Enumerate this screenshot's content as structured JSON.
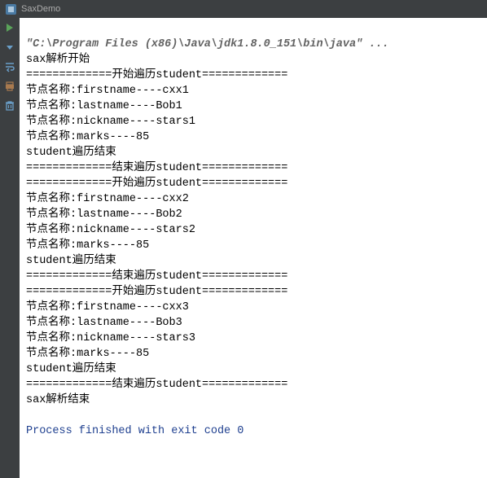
{
  "title": "SaxDemo",
  "console": {
    "command": "\"C:\\Program Files (x86)\\Java\\jdk1.8.0_151\\bin\\java\" ...",
    "lines": [
      "sax解析开始",
      "=============开始遍历student=============",
      "节点名称:firstname----cxx1",
      "节点名称:lastname----Bob1",
      "节点名称:nickname----stars1",
      "节点名称:marks----85",
      "student遍历结束",
      "=============结束遍历student=============",
      "=============开始遍历student=============",
      "节点名称:firstname----cxx2",
      "节点名称:lastname----Bob2",
      "节点名称:nickname----stars2",
      "节点名称:marks----85",
      "student遍历结束",
      "=============结束遍历student=============",
      "=============开始遍历student=============",
      "节点名称:firstname----cxx3",
      "节点名称:lastname----Bob3",
      "节点名称:nickname----stars3",
      "节点名称:marks----85",
      "student遍历结束",
      "=============结束遍历student=============",
      "sax解析结束",
      ""
    ],
    "exit": "Process finished with exit code 0"
  },
  "icons": {
    "rerun": "rerun-icon",
    "stop": "stop-icon",
    "restore": "restore-icon",
    "pin": "pin-icon",
    "print": "print-icon",
    "trash": "trash-icon"
  }
}
